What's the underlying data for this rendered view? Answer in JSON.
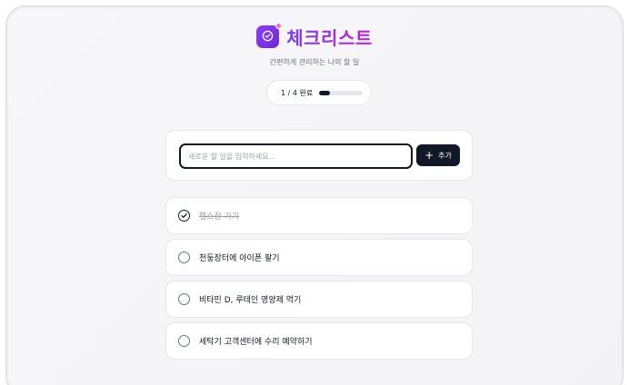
{
  "header": {
    "title": "체크리스트",
    "subtitle": "간편하게 관리하는 나의 할 일"
  },
  "progress": {
    "completed": 1,
    "total": 4,
    "label": "1 / 4 완료"
  },
  "input": {
    "placeholder": "새로운 할 일을 입력하세요...",
    "value": "",
    "add_label": "추가"
  },
  "todos": [
    {
      "text": "헬스장 가기",
      "done": true
    },
    {
      "text": "천둥장터에 아이폰 팔기",
      "done": false
    },
    {
      "text": "비타민 D, 루테인 영양제 먹기",
      "done": false
    },
    {
      "text": "세탁기 고객센터에 수리 예약하기",
      "done": false
    }
  ],
  "colors": {
    "accent": "#7c3aed",
    "accent2": "#c026d3",
    "dark": "#111827"
  },
  "icons": {
    "logo": "check-circle-icon",
    "add": "plus-icon",
    "todo_done": "check-circle-icon",
    "todo_open": "empty-circle-icon"
  }
}
